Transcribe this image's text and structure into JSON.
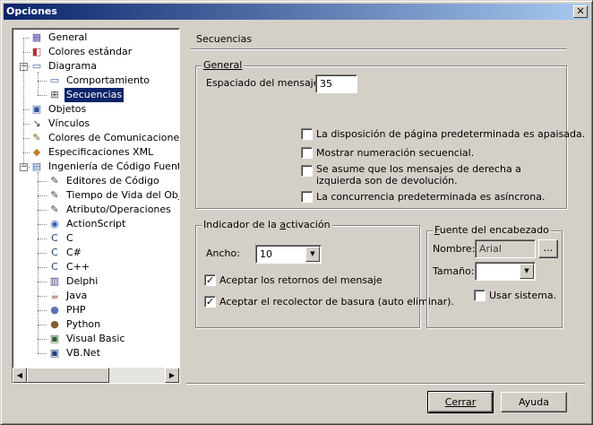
{
  "window": {
    "title": "Opciones",
    "close_glyph": "✕"
  },
  "tree": {
    "items": [
      {
        "label": "General",
        "icon": "general-icon",
        "glyph": "▦",
        "color": "#5050a0",
        "level": 1
      },
      {
        "label": "Colores estándar",
        "icon": "colors-icon",
        "glyph": "◧",
        "color": "#b03030",
        "level": 1
      },
      {
        "label": "Diagrama",
        "icon": "diagram-icon",
        "glyph": "▭",
        "color": "#4060a0",
        "level": 1,
        "expander": "−"
      },
      {
        "label": "Comportamiento",
        "icon": "behavior-icon",
        "glyph": "▭",
        "color": "#4060a0",
        "level": 2
      },
      {
        "label": "Secuencias",
        "icon": "sequence-icon",
        "glyph": "⊞",
        "color": "#404040",
        "level": 2,
        "selected": true
      },
      {
        "label": "Objetos",
        "icon": "objects-icon",
        "glyph": "▣",
        "color": "#3050a0",
        "level": 1
      },
      {
        "label": "Vínculos",
        "icon": "links-icon",
        "glyph": "↘",
        "color": "#404040",
        "level": 1
      },
      {
        "label": "Colores de Comunicaciones",
        "icon": "communication-colors-icon",
        "glyph": "✎",
        "color": "#806020",
        "level": 1
      },
      {
        "label": "Especificaciones XML",
        "icon": "xml-icon",
        "glyph": "◆",
        "color": "#c08020",
        "level": 1
      },
      {
        "label": "Ingeniería de Código Fuente",
        "icon": "source-engineering-icon",
        "glyph": "▤",
        "color": "#4060a0",
        "level": 1,
        "expander": "−"
      },
      {
        "label": "Editores de Código",
        "icon": "code-editor-icon",
        "glyph": "✎",
        "color": "#404040",
        "level": 2
      },
      {
        "label": "Tiempo de Vida del Objeto",
        "icon": "object-lifetime-icon",
        "glyph": "✎",
        "color": "#404040",
        "level": 2
      },
      {
        "label": "Atributo/Operaciones",
        "icon": "attribute-icon",
        "glyph": "✎",
        "color": "#404040",
        "level": 2
      },
      {
        "label": "ActionScript",
        "icon": "actionscript-icon",
        "glyph": "◉",
        "color": "#3060c0",
        "level": 2
      },
      {
        "label": "C",
        "icon": "c-icon",
        "glyph": "C",
        "color": "#204080",
        "level": 2
      },
      {
        "label": "C#",
        "icon": "csharp-icon",
        "glyph": "C",
        "color": "#204080",
        "level": 2
      },
      {
        "label": "C++",
        "icon": "cpp-icon",
        "glyph": "C",
        "color": "#204080",
        "level": 2
      },
      {
        "label": "Delphi",
        "icon": "delphi-icon",
        "glyph": "▥",
        "color": "#404080",
        "level": 2
      },
      {
        "label": "Java",
        "icon": "java-icon",
        "glyph": "☕",
        "color": "#804020",
        "level": 2
      },
      {
        "label": "PHP",
        "icon": "php-icon",
        "glyph": "●",
        "color": "#6070b0",
        "level": 2
      },
      {
        "label": "Python",
        "icon": "python-icon",
        "glyph": "●",
        "color": "#806030",
        "level": 2
      },
      {
        "label": "Visual Basic",
        "icon": "visual-basic-icon",
        "glyph": "▣",
        "color": "#306030",
        "level": 2
      },
      {
        "label": "VB.Net",
        "icon": "vbnet-icon",
        "glyph": "▣",
        "color": "#204080",
        "level": 2
      }
    ],
    "scroll_left": "◀",
    "scroll_right": "▶"
  },
  "page": {
    "title": "Secuencias",
    "general": {
      "legend": "General",
      "message_spacing_label": "Espaciado del mensaje:",
      "message_spacing_value": "35",
      "checkboxes": [
        {
          "label": "La disposición de página predeterminada es apaisada.",
          "checked": false
        },
        {
          "label": "Mostrar numeración secuencial.",
          "checked": false
        },
        {
          "label": "Se asume que los mensajes de derecha a izquierda son de devolución.",
          "checked": false
        },
        {
          "label": "La concurrencia predeterminada es asíncrona.",
          "checked": false
        }
      ]
    },
    "activation": {
      "legend_pre": "Indicador de la ",
      "legend_u": "a",
      "legend_post": "ctivación",
      "width_label": "Ancho:",
      "width_value": "10",
      "check_returns": {
        "label": "Aceptar los retornos del mensaje",
        "checked": true
      },
      "check_gc": {
        "label": "Aceptar el recolector de basura (auto eliminar).",
        "checked": true
      }
    },
    "header_font": {
      "legend_u": "F",
      "legend_post": "uente del encabezado",
      "name_label": "Nombre:",
      "name_value": "Arial",
      "browse_label": "...",
      "size_label": "Tamaño:",
      "size_value": "",
      "use_system": {
        "label": "Usar sistema.",
        "checked": false
      }
    }
  },
  "buttons": {
    "close": "Cerrar",
    "help": "Ayuda"
  },
  "glyphs": {
    "check": "✓",
    "dropdown": "▼"
  }
}
